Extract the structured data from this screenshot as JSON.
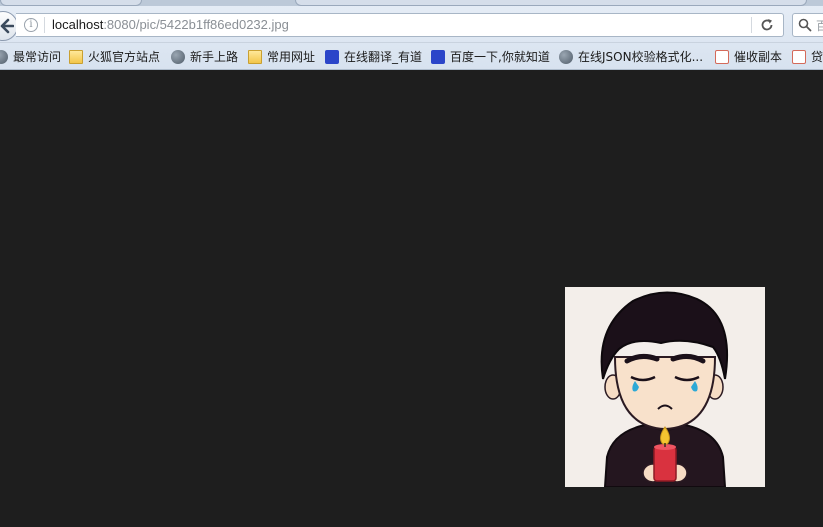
{
  "browser": {
    "url_host": "localhost",
    "url_path": ":8080/pic/5422b1ff86ed0232.jpg",
    "search_placeholder": "百"
  },
  "bookmarks": [
    {
      "label": "最常访问",
      "icon": "globe-icon"
    },
    {
      "label": "火狐官方站点",
      "icon": "folder-icon"
    },
    {
      "label": "新手上路",
      "icon": "globe-icon"
    },
    {
      "label": "常用网址",
      "icon": "folder-icon"
    },
    {
      "label": "在线翻译_有道",
      "icon": "paw-icon"
    },
    {
      "label": "百度一下,你就知道",
      "icon": "paw-icon"
    },
    {
      "label": "在线JSON校验格式化...",
      "icon": "globe-icon"
    },
    {
      "label": "催收副本",
      "icon": "page-icon"
    },
    {
      "label": "贷",
      "icon": "page-icon"
    }
  ],
  "content": {
    "image_alt": "cartoon boy crying holding a candle",
    "colors": {
      "background": "#1e1e1e",
      "image_bg": "#f3eeea"
    }
  }
}
